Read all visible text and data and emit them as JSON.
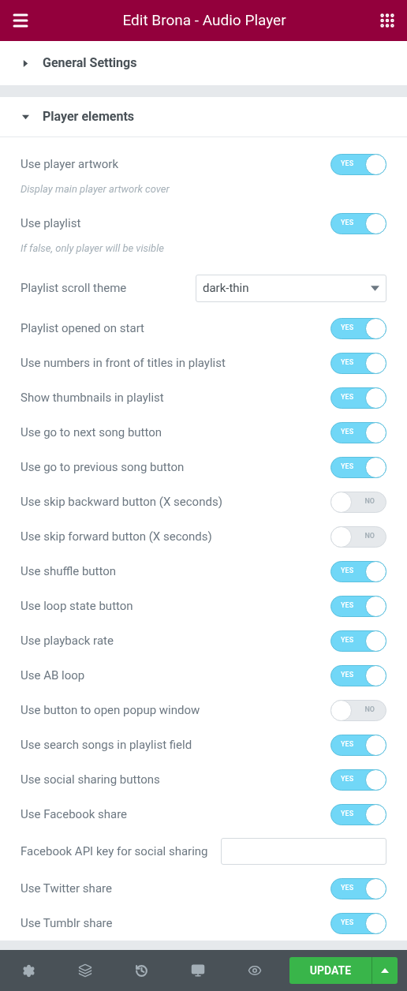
{
  "header": {
    "title": "Edit Brona - Audio Player"
  },
  "sections": [
    {
      "title": "General Settings",
      "expanded": false
    },
    {
      "title": "Player elements",
      "expanded": true,
      "controls": [
        {
          "kind": "toggle",
          "label": "Use player artwork",
          "on": true,
          "state_text": "YES",
          "description": "Display main player artwork cover"
        },
        {
          "kind": "toggle",
          "label": "Use playlist",
          "on": true,
          "state_text": "YES",
          "description": "If false, only player will be visible"
        },
        {
          "kind": "select",
          "label": "Playlist scroll theme",
          "value": "dark-thin"
        },
        {
          "kind": "toggle",
          "label": "Playlist opened on start",
          "on": true,
          "state_text": "YES"
        },
        {
          "kind": "toggle",
          "label": "Use numbers in front of titles in playlist",
          "on": true,
          "state_text": "YES"
        },
        {
          "kind": "toggle",
          "label": "Show thumbnails in playlist",
          "on": true,
          "state_text": "YES"
        },
        {
          "kind": "toggle",
          "label": "Use go to next song button",
          "on": true,
          "state_text": "YES"
        },
        {
          "kind": "toggle",
          "label": "Use go to previous song button",
          "on": true,
          "state_text": "YES"
        },
        {
          "kind": "toggle",
          "label": "Use skip backward button (X seconds)",
          "on": false,
          "state_text": "NO"
        },
        {
          "kind": "toggle",
          "label": "Use skip forward button (X seconds)",
          "on": false,
          "state_text": "NO"
        },
        {
          "kind": "toggle",
          "label": "Use shuffle button",
          "on": true,
          "state_text": "YES"
        },
        {
          "kind": "toggle",
          "label": "Use loop state button",
          "on": true,
          "state_text": "YES"
        },
        {
          "kind": "toggle",
          "label": "Use playback rate",
          "on": true,
          "state_text": "YES"
        },
        {
          "kind": "toggle",
          "label": "Use AB loop",
          "on": true,
          "state_text": "YES"
        },
        {
          "kind": "toggle",
          "label": "Use button to open popup window",
          "on": false,
          "state_text": "NO"
        },
        {
          "kind": "toggle",
          "label": "Use search songs in playlist field",
          "on": true,
          "state_text": "YES"
        },
        {
          "kind": "toggle",
          "label": "Use social sharing buttons",
          "on": true,
          "state_text": "YES"
        },
        {
          "kind": "toggle",
          "label": "Use Facebook share",
          "on": true,
          "state_text": "YES"
        },
        {
          "kind": "text",
          "label": "Facebook API key for social sharing"
        },
        {
          "kind": "toggle",
          "label": "Use Twitter share",
          "on": true,
          "state_text": "YES"
        },
        {
          "kind": "toggle",
          "label": "Use Tumblr share",
          "on": true,
          "state_text": "YES"
        }
      ]
    }
  ],
  "footer": {
    "update_button": "UPDATE"
  }
}
